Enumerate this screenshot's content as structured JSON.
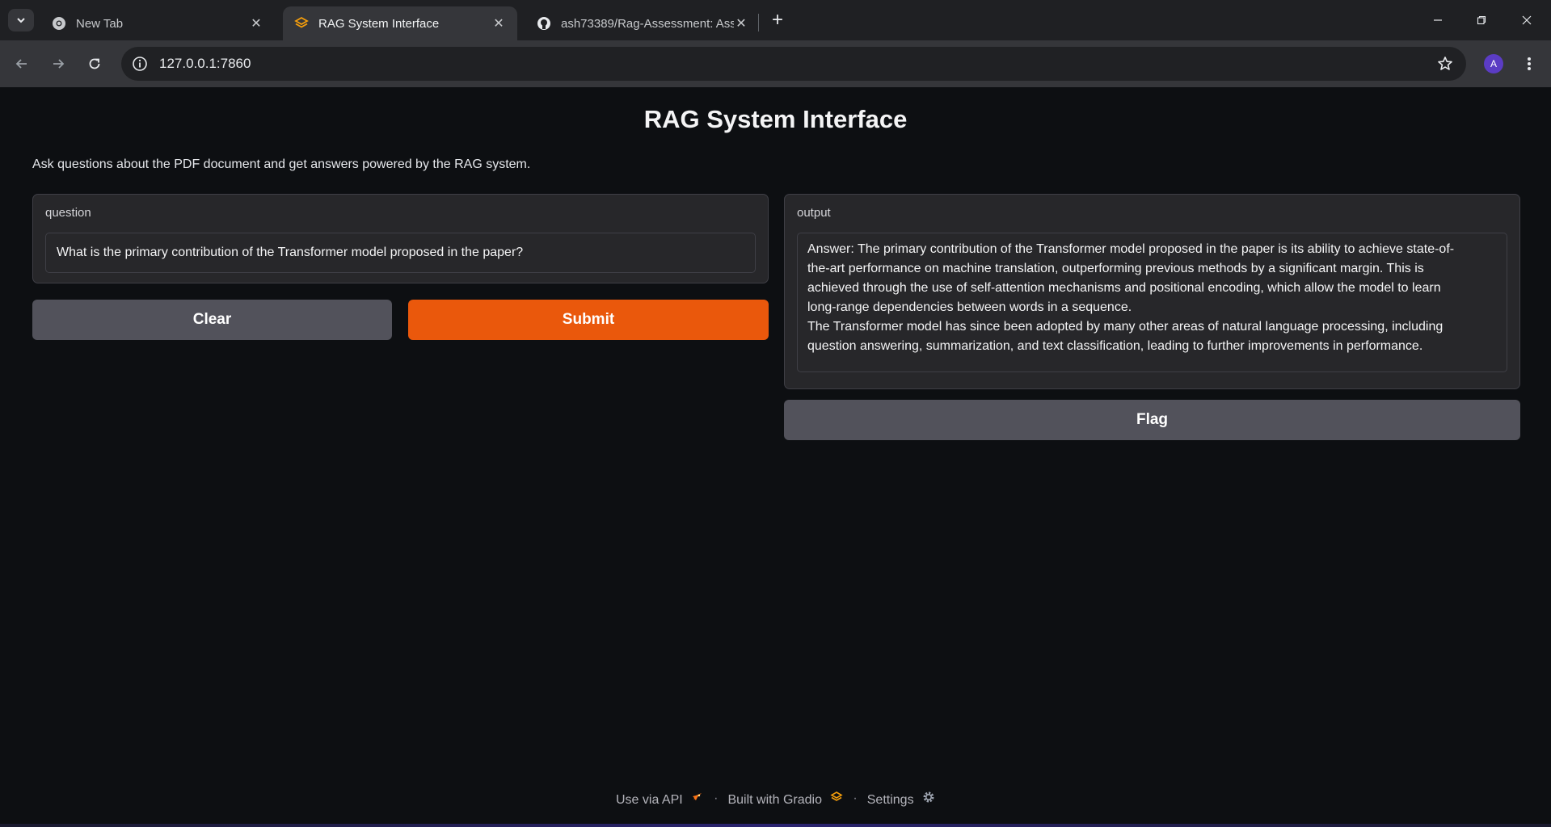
{
  "browser": {
    "tabs": [
      {
        "title": "New Tab",
        "favicon": "chrome-icon",
        "active": false
      },
      {
        "title": "RAG System Interface",
        "favicon": "gradio-icon",
        "active": true
      },
      {
        "title": "ash73389/Rag-Assessment: Ass",
        "favicon": "github-icon",
        "active": false
      }
    ],
    "url": "127.0.0.1:7860",
    "profile_initial": "A",
    "new_tab_symbol": "+"
  },
  "app": {
    "title": "RAG System Interface",
    "description": "Ask questions about the PDF document and get answers powered by the RAG system.",
    "input": {
      "label": "question",
      "value": "What is the primary contribution of the Transformer model proposed in the paper?"
    },
    "output": {
      "label": "output",
      "lines": [
        "Answer: The primary contribution of the Transformer model proposed in the paper is its ability to achieve state-of-",
        "the-art performance on machine translation, outperforming previous methods by a significant margin. This is",
        "achieved through the use of self-attention mechanisms and positional encoding, which allow the model to learn",
        "long-range dependencies between words in a sequence.",
        "The Transformer model has since been adopted by many other areas of natural language processing, including",
        "question answering, summarization, and text classification, leading to further improvements in performance."
      ]
    },
    "buttons": {
      "clear": "Clear",
      "submit": "Submit",
      "flag": "Flag"
    },
    "footer": {
      "api": "Use via API",
      "built": "Built with Gradio",
      "settings": "Settings",
      "separator": "·"
    }
  },
  "colors": {
    "primary": "#ea580c",
    "secondary": "#52525b",
    "background": "#0d0f12",
    "panel": "#27272a"
  }
}
